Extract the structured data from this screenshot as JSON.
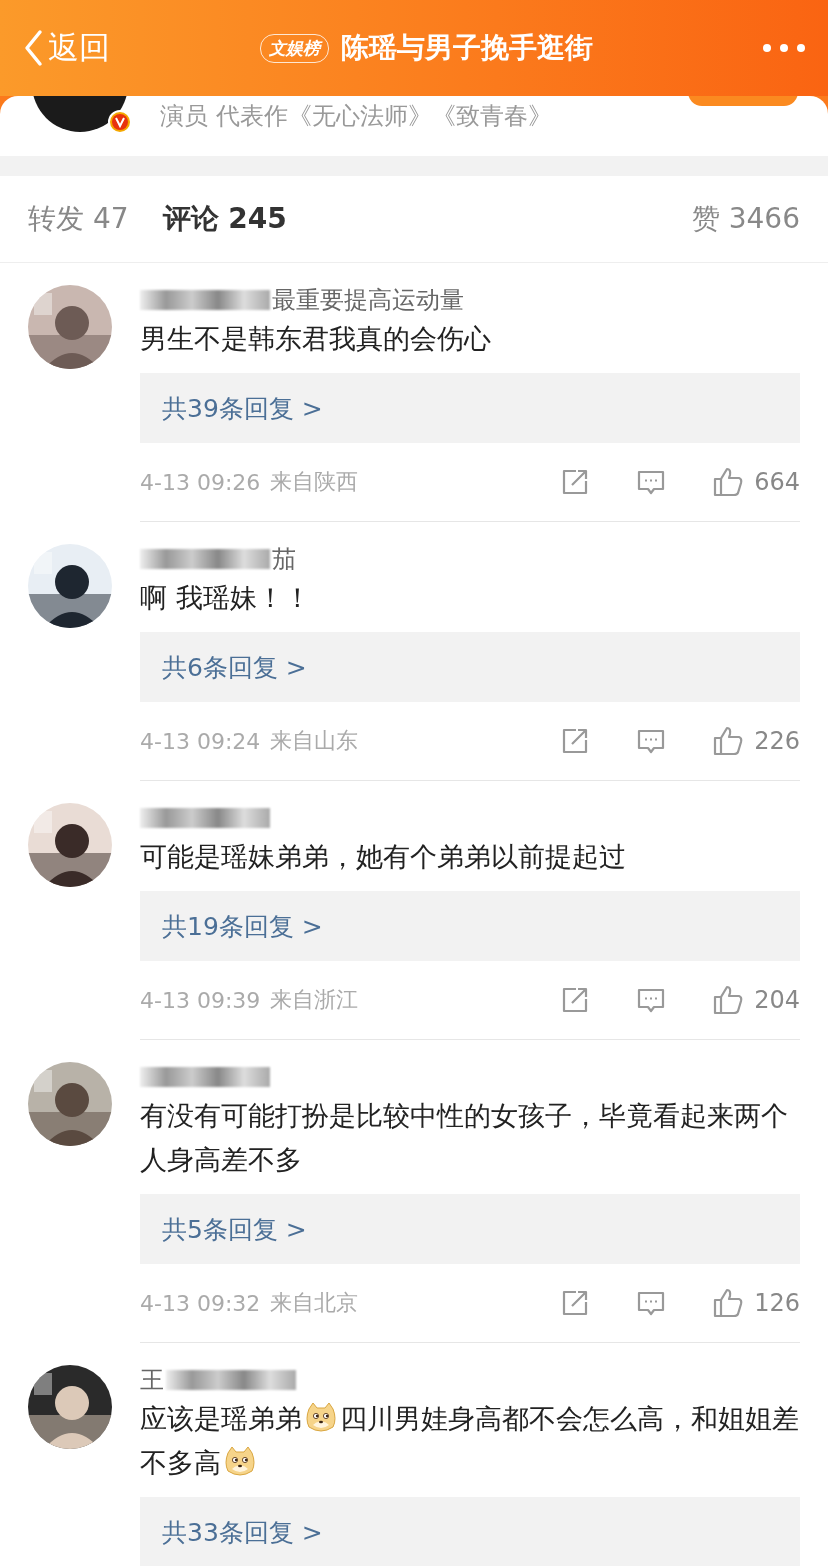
{
  "header": {
    "back": "返回",
    "badge": "文娱榜",
    "title": "陈瑶与男子挽手逛街"
  },
  "profile": {
    "verified": true,
    "description": "演员 代表作《无心法师》《致青春》"
  },
  "tabs": [
    {
      "label": "转发 47",
      "selected": false
    },
    {
      "label": "评论 245",
      "selected": true
    },
    {
      "label": "赞 3466",
      "selected": false
    }
  ],
  "comments": [
    {
      "name": {
        "text": "最重要提高运动量",
        "blur_before": true,
        "blur_after": false
      },
      "segments": [
        {
          "kind": "text",
          "text": "男生不是韩东君我真的会伤心"
        }
      ],
      "replies": "共39条回复 >",
      "time": "4-13 09:26",
      "location": "来自陕西",
      "likes": "664"
    },
    {
      "name": {
        "text": "茄",
        "blur_before": true,
        "blur_after": false
      },
      "segments": [
        {
          "kind": "text",
          "text": "啊 我瑶妹！！"
        }
      ],
      "replies": "共6条回复 >",
      "time": "4-13 09:24",
      "location": "来自山东",
      "likes": "226"
    },
    {
      "name": {
        "blur_before": true,
        "blur_after": false
      },
      "segments": [
        {
          "kind": "text",
          "text": "可能是瑶妹弟弟，她有个弟弟以前提起过"
        }
      ],
      "replies": "共19条回复 >",
      "time": "4-13 09:39",
      "location": "来自浙江",
      "likes": "204"
    },
    {
      "name": {
        "blur_before": true,
        "blur_after": false
      },
      "segments": [
        {
          "kind": "text",
          "text": "有没有可能打扮是比较中性的女孩子，毕竟看起来两个人身高差不多"
        }
      ],
      "replies": "共5条回复 >",
      "time": "4-13 09:32",
      "location": "来自北京",
      "likes": "126"
    },
    {
      "name": {
        "text": "王",
        "blur_before": false,
        "blur_after": true
      },
      "segments": [
        {
          "kind": "text",
          "text": "应该是瑶弟弟"
        },
        {
          "kind": "emoji"
        },
        {
          "kind": "text",
          "text": "四川男娃身高都不会怎么高，和姐姐差不多高"
        },
        {
          "kind": "emoji"
        }
      ],
      "replies": "共33条回复 >"
    }
  ]
}
